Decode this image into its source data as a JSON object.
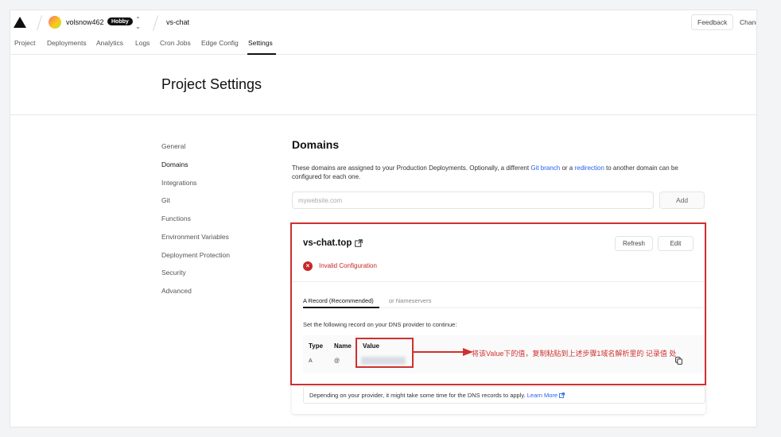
{
  "header": {
    "username": "volsnow462",
    "plan_badge": "Hobby",
    "switcher_glyph": "⌃⌄",
    "project_name": "vs-chat",
    "feedback_label": "Feedback",
    "changelog_label": "Chang"
  },
  "nav": {
    "tabs": [
      {
        "label": "Project"
      },
      {
        "label": "Deployments"
      },
      {
        "label": "Analytics"
      },
      {
        "label": "Logs"
      },
      {
        "label": "Cron Jobs"
      },
      {
        "label": "Edge Config"
      },
      {
        "label": "Settings",
        "active": true
      }
    ]
  },
  "page": {
    "title": "Project Settings"
  },
  "sidebar": {
    "items": [
      {
        "label": "General"
      },
      {
        "label": "Domains",
        "active": true
      },
      {
        "label": "Integrations"
      },
      {
        "label": "Git"
      },
      {
        "label": "Functions"
      },
      {
        "label": "Environment Variables"
      },
      {
        "label": "Deployment Protection"
      },
      {
        "label": "Security"
      },
      {
        "label": "Advanced"
      }
    ]
  },
  "domains": {
    "title": "Domains",
    "desc_part1": "These domains are assigned to your Production Deployments. Optionally, a different ",
    "desc_link1": "Git branch",
    "desc_part2": " or a ",
    "desc_link2": "redirection",
    "desc_part3": " to another domain can be configured for each one.",
    "input_placeholder": "mywebsite.com",
    "add_label": "Add"
  },
  "domain_card": {
    "name": "vs-chat.top",
    "refresh_label": "Refresh",
    "edit_label": "Edit",
    "status": "Invalid Configuration",
    "status_icon": "x-circle-icon",
    "tab_a_record": "A Record (Recommended)",
    "tab_nameservers": "or Nameservers",
    "instruction": "Set the following record on your DNS provider to continue:",
    "table": {
      "headers": [
        "Type",
        "Name",
        "Value"
      ],
      "row": {
        "type": "A",
        "name": "@"
      }
    },
    "note_text": "Depending on your provider, it might take some time for the DNS records to apply. ",
    "note_link": "Learn More"
  },
  "annotation": {
    "text": "将该Value下的值，复制粘贴到上述步骤1域名解析里的 记录值 处"
  },
  "colors": {
    "annotation": "#d03030",
    "error": "#c62828",
    "link": "#2563eb"
  }
}
